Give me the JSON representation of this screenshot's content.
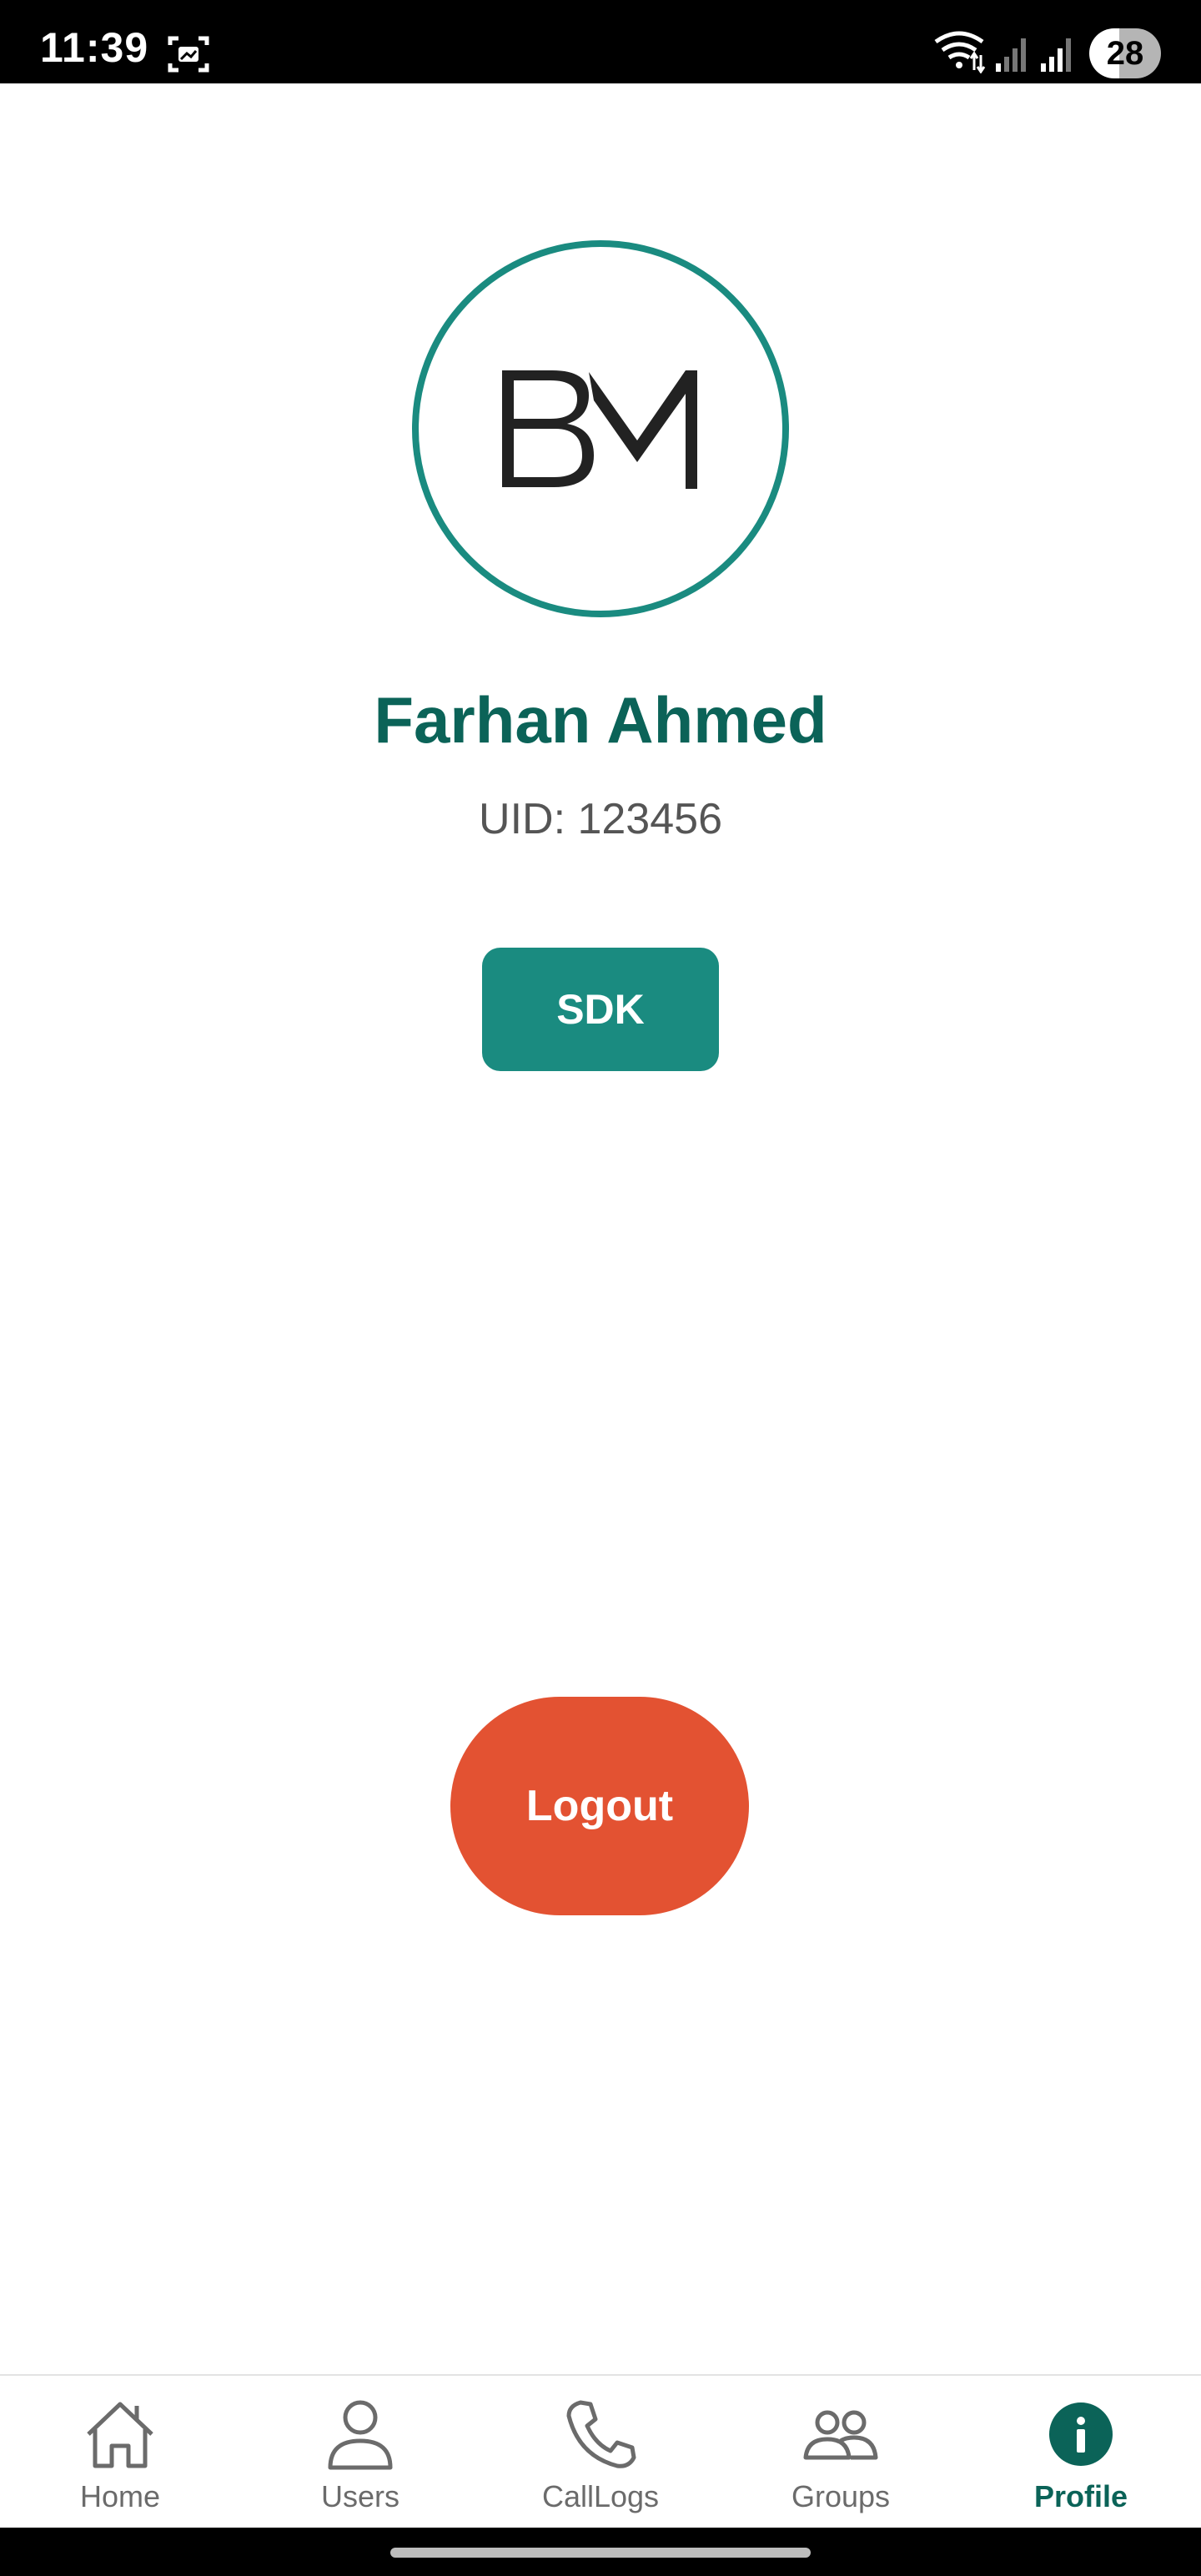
{
  "status_bar": {
    "time": "11:39",
    "battery": "28",
    "icons": [
      "screenshot-icon",
      "wifi-icon",
      "signal-icon",
      "signal-icon",
      "battery-icon"
    ]
  },
  "profile": {
    "avatar_logo": "BM",
    "name": "Farhan Ahmed",
    "uid": "UID: 123456"
  },
  "actions": {
    "sdk_label": "SDK",
    "logout_label": "Logout"
  },
  "bottom_nav": {
    "items": [
      {
        "label": "Home",
        "icon": "home-icon"
      },
      {
        "label": "Users",
        "icon": "user-icon"
      },
      {
        "label": "CallLogs",
        "icon": "phone-icon"
      },
      {
        "label": "Groups",
        "icon": "groups-icon"
      },
      {
        "label": "Profile",
        "icon": "info-icon",
        "active": true
      }
    ]
  },
  "colors": {
    "primary": "#0b6358",
    "accent": "#1a8b80",
    "logout": "#e35232",
    "inactive": "#6b6b6b"
  }
}
